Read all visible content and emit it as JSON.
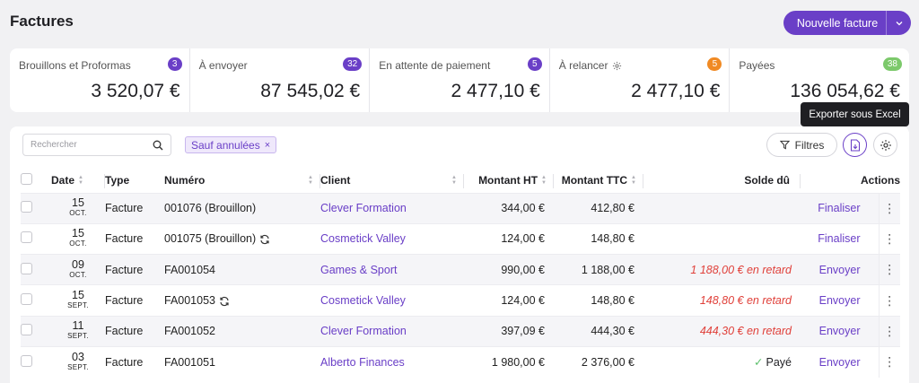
{
  "header": {
    "title": "Factures",
    "new_invoice_label": "Nouvelle facture"
  },
  "colors": {
    "accent": "#6a3fc7",
    "late": "#e0403a",
    "paid_check": "#5bbf6b"
  },
  "stats": [
    {
      "label": "Brouillons et Proformas",
      "badge": "3",
      "badge_color": "#6a3fc7",
      "value": "3 520,07 €"
    },
    {
      "label": "À envoyer",
      "badge": "32",
      "badge_color": "#6a3fc7",
      "value": "87 545,02 €"
    },
    {
      "label": "En attente de paiement",
      "badge": "5",
      "badge_color": "#6a3fc7",
      "value": "2 477,10 €"
    },
    {
      "label": "À relancer",
      "badge": "5",
      "badge_color": "#f08a24",
      "value": "2 477,10 €",
      "icon": "gear-icon"
    },
    {
      "label": "Payées",
      "badge": "38",
      "badge_color": "#7cc96b",
      "value": "136 054,62 €"
    }
  ],
  "toolbar": {
    "search_placeholder": "Rechercher",
    "filter_chip": "Sauf annulées",
    "filter_chip_remove": "×",
    "filters_label": "Filtres",
    "export_tooltip": "Exporter sous Excel"
  },
  "table": {
    "columns": {
      "date": "Date",
      "type": "Type",
      "numero": "Numéro",
      "client": "Client",
      "ht": "Montant HT",
      "ttc": "Montant TTC",
      "solde": "Solde dû",
      "actions": "Actions"
    },
    "rows": [
      {
        "day": "15",
        "month": "OCT.",
        "type": "Facture",
        "numero": "001076 (Brouillon)",
        "refresh": false,
        "client": "Clever Formation",
        "ht": "344,00 €",
        "ttc": "412,80 €",
        "solde": "",
        "solde_kind": "none",
        "action": "Finaliser"
      },
      {
        "day": "15",
        "month": "OCT.",
        "type": "Facture",
        "numero": "001075 (Brouillon)",
        "refresh": true,
        "client": "Cosmetick Valley",
        "ht": "124,00 €",
        "ttc": "148,80 €",
        "solde": "",
        "solde_kind": "none",
        "action": "Finaliser"
      },
      {
        "day": "09",
        "month": "OCT.",
        "type": "Facture",
        "numero": "FA001054",
        "refresh": false,
        "client": "Games & Sport",
        "ht": "990,00 €",
        "ttc": "1 188,00 €",
        "solde": "1 188,00 € en retard",
        "solde_kind": "late",
        "action": "Envoyer"
      },
      {
        "day": "15",
        "month": "SEPT.",
        "type": "Facture",
        "numero": "FA001053",
        "refresh": true,
        "client": "Cosmetick Valley",
        "ht": "124,00 €",
        "ttc": "148,80 €",
        "solde": "148,80 € en retard",
        "solde_kind": "late",
        "action": "Envoyer"
      },
      {
        "day": "11",
        "month": "SEPT.",
        "type": "Facture",
        "numero": "FA001052",
        "refresh": false,
        "client": "Clever Formation",
        "ht": "397,09 €",
        "ttc": "444,30 €",
        "solde": "444,30 € en retard",
        "solde_kind": "late",
        "action": "Envoyer"
      },
      {
        "day": "03",
        "month": "SEPT.",
        "type": "Facture",
        "numero": "FA001051",
        "refresh": false,
        "client": "Alberto Finances",
        "ht": "1 980,00 €",
        "ttc": "2 376,00 €",
        "solde": "Payé",
        "solde_kind": "paid",
        "action": "Envoyer"
      }
    ]
  }
}
